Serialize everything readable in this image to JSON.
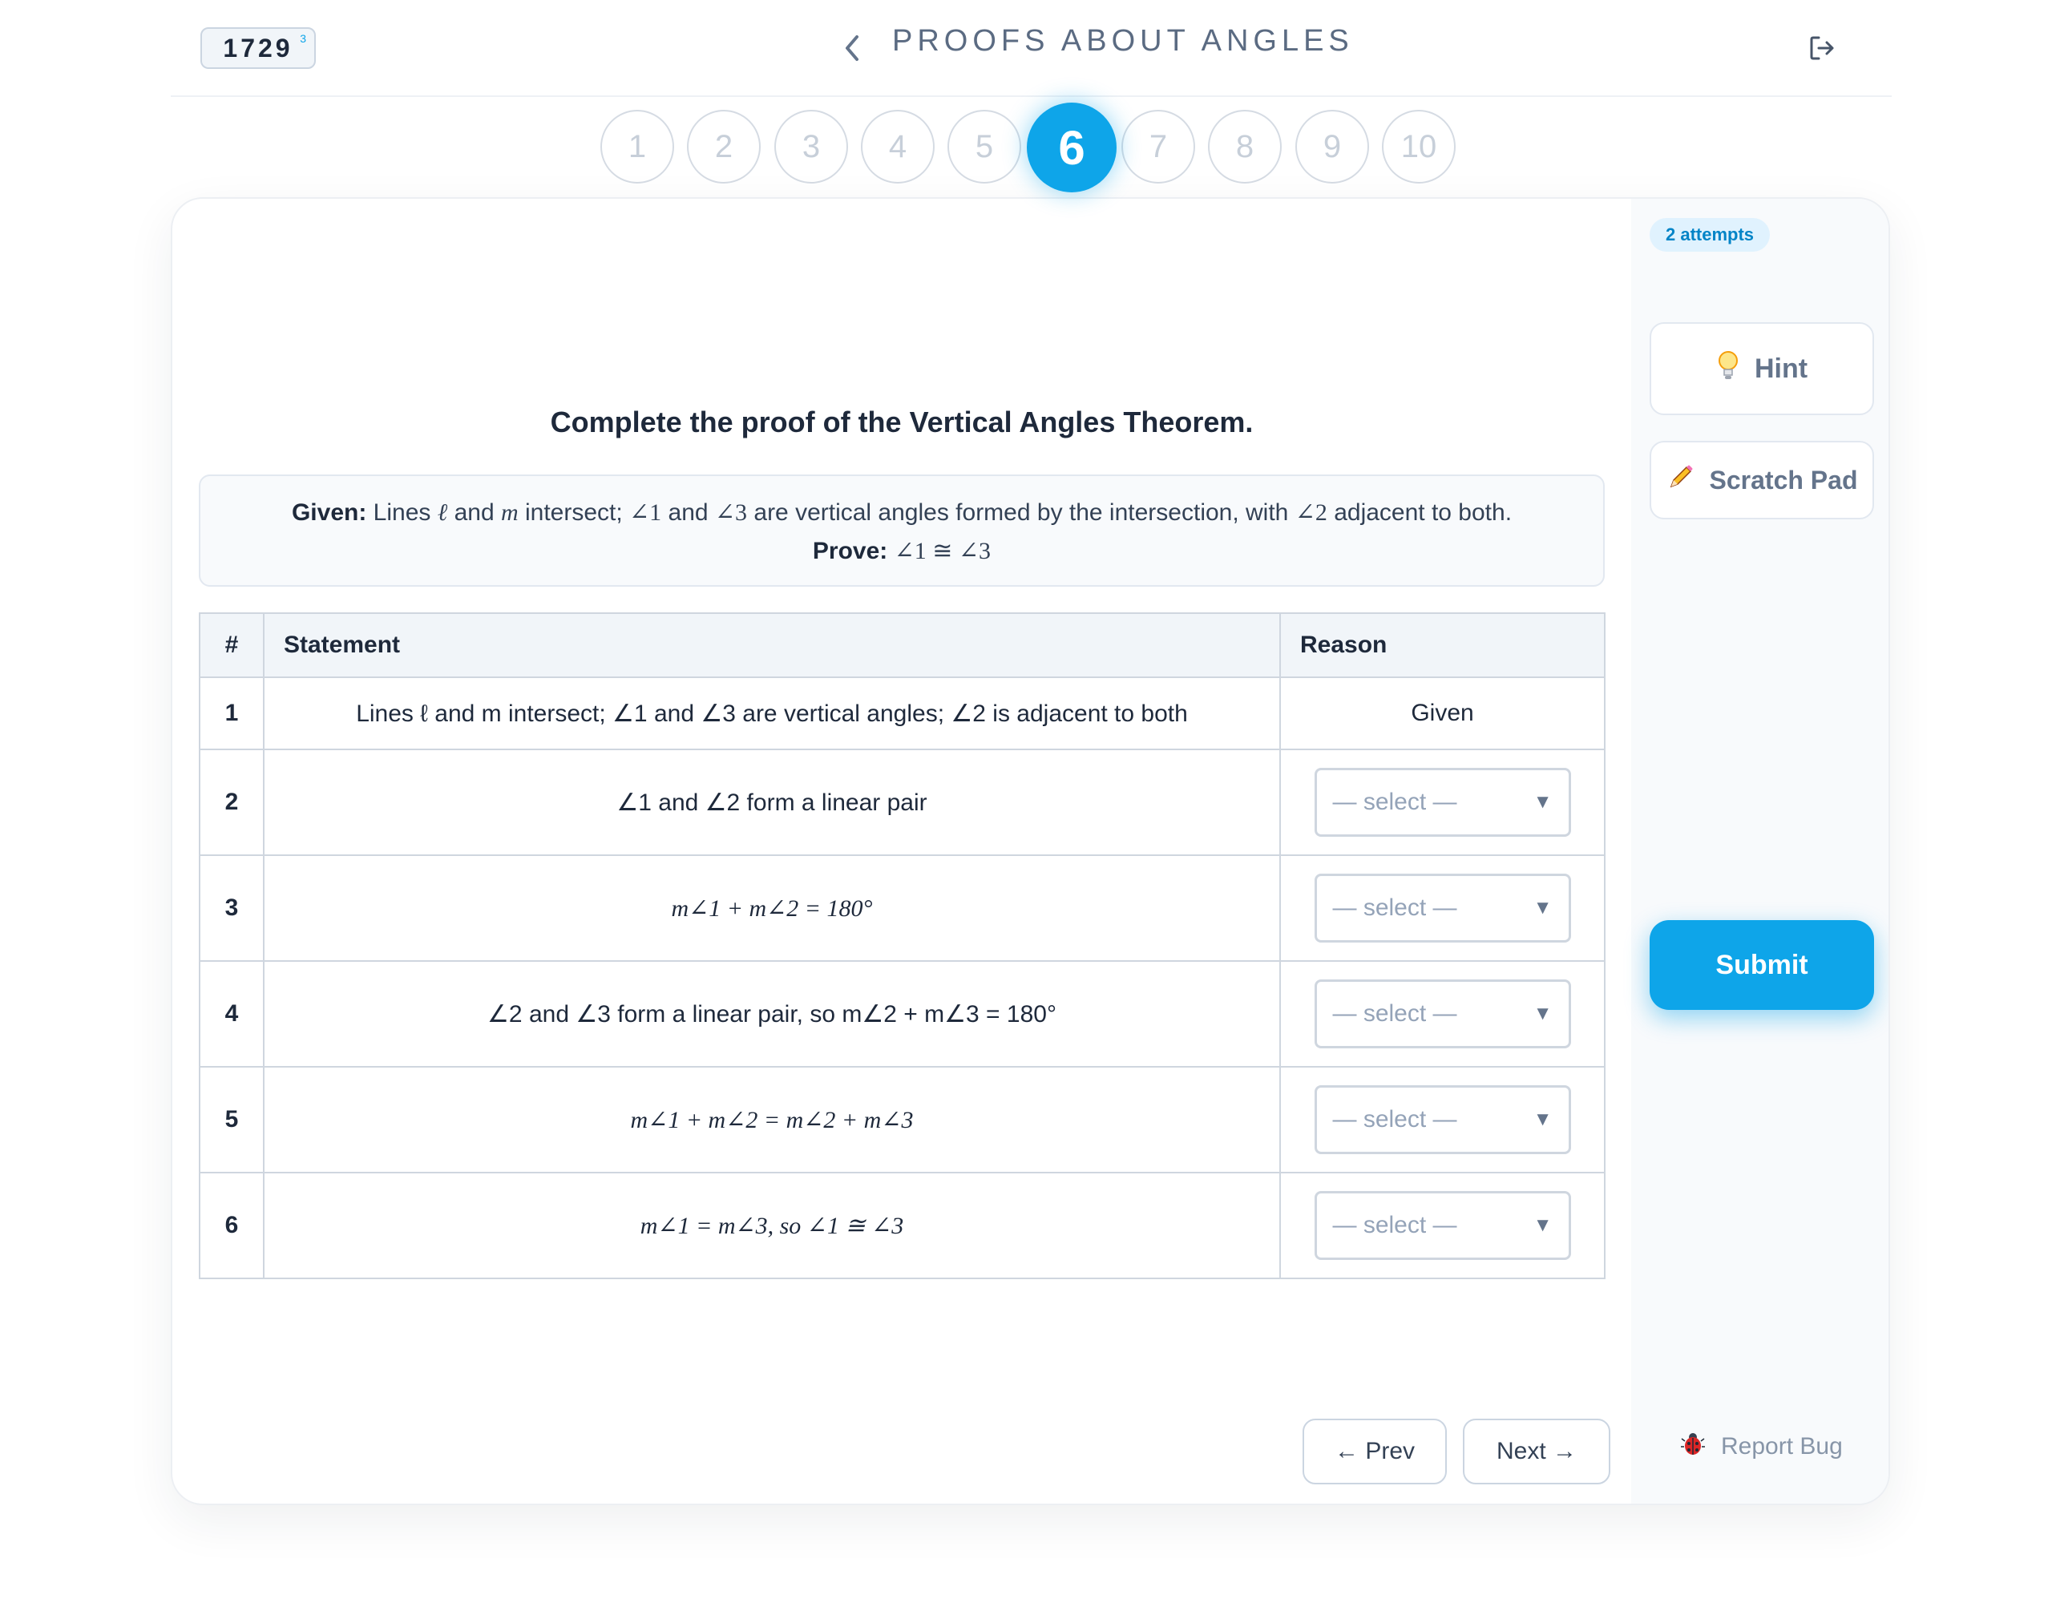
{
  "header": {
    "score": "1729",
    "score_badge": "3",
    "title": "PROOFS ABOUT ANGLES",
    "back_icon": "chevron-left-icon",
    "exit_icon": "logout-icon"
  },
  "steps": {
    "items": [
      "1",
      "2",
      "3",
      "4",
      "5",
      "6",
      "7",
      "8",
      "9",
      "10"
    ],
    "active": "6"
  },
  "question": {
    "prompt": "Complete the proof of the Vertical Angles Theorem.",
    "given_label": "Given:",
    "given_parts": [
      "Lines ",
      "ℓ",
      " and ",
      "m",
      " intersect; ",
      "∠1",
      " and ",
      "∠3",
      " are vertical angles formed by the intersection, with ",
      "∠2",
      " adjacent to both."
    ],
    "prove_label": "Prove:",
    "prove_text": "∠1 ≅ ∠3"
  },
  "table": {
    "headers": [
      "#",
      "Statement",
      "Reason"
    ],
    "rows": [
      {
        "num": "1",
        "statement": "Lines ℓ and m intersect; ∠1 and ∠3 are vertical angles; ∠2 is adjacent to both",
        "reason": "Given"
      },
      {
        "num": "2",
        "statement": "∠1 and ∠2 form a linear pair",
        "reason_placeholder": "— select —"
      },
      {
        "num": "3",
        "statement": "m∠1 + m∠2 = 180°",
        "reason_placeholder": "— select —"
      },
      {
        "num": "4",
        "statement": "∠2 and ∠3 form a linear pair, so m∠2 + m∠3 = 180°",
        "reason_placeholder": "— select —"
      },
      {
        "num": "5",
        "statement": "m∠1 + m∠2 = m∠2 + m∠3",
        "reason_placeholder": "— select —"
      },
      {
        "num": "6",
        "statement": "m∠1 = m∠3, so ∠1 ≅ ∠3",
        "reason_placeholder": "— select —"
      }
    ]
  },
  "nav": {
    "prev_label": "← Prev",
    "next_label": "Next →"
  },
  "sidebar": {
    "attempts": "2 attempts",
    "hint_label": "Hint",
    "hint_icon": "lightbulb-icon",
    "scratch_label": "Scratch Pad",
    "scratch_icon": "pencil-icon",
    "submit_label": "Submit",
    "report_label": "Report Bug",
    "report_icon": "bug-icon"
  },
  "colors": {
    "accent": "#0ea5e9",
    "text": "#1e293b",
    "muted": "#64748b"
  }
}
